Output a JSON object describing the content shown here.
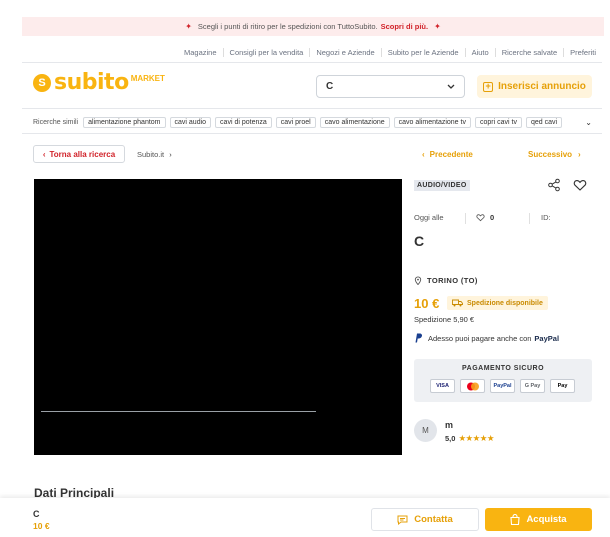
{
  "banner": {
    "text": "Scegli i punti di ritiro per le spedizioni con TuttoSubito.",
    "link": "Scopri di più."
  },
  "top_links": [
    "Magazine",
    "Consigli per la vendita",
    "Negozi e Aziende",
    "Subito per le Aziende",
    "Aiuto",
    "Ricerche salvate",
    "Preferiti"
  ],
  "logo": {
    "word": "subito",
    "sub": "MARKET"
  },
  "search": {
    "value": "C"
  },
  "header": {
    "insert_label": "Inserisci annuncio"
  },
  "related": {
    "label": "Ricerche simili",
    "chips": [
      "alimentazione phantom",
      "cavi audio",
      "cavi di potenza",
      "cavi proel",
      "cavo alimentazione",
      "cavo alimentazione tv",
      "copri cavi tv",
      "qed cavi"
    ]
  },
  "nav": {
    "back": "Torna alla ricerca",
    "crumb": "Subito.it",
    "prev": "Precedente",
    "next": "Successivo"
  },
  "ad": {
    "category": "AUDIO/VIDEO",
    "date": "Oggi alle",
    "likes": "0",
    "id_label": "ID:",
    "title": "C",
    "location": "TORINO (TO)",
    "price": "10 €",
    "shipping_badge": "Spedizione disponibile",
    "shipping_cost": "Spedizione 5,90 €",
    "paypal_text": "Adesso puoi pagare anche con",
    "paypal_brand": "PayPal",
    "secure_title": "PAGAMENTO SICURO",
    "cards": [
      "VISA",
      "MC",
      "PayPal",
      "G Pay",
      "Pay"
    ]
  },
  "seller": {
    "initial": "M",
    "name": "m",
    "rating": "5,0",
    "stars": "★★★★★"
  },
  "section": {
    "title": "Dati Principali"
  },
  "bottom": {
    "title": "C",
    "price": "10 €",
    "contact": "Contatta",
    "buy": "Acquista"
  },
  "colors": {
    "accent": "#f9b411",
    "red": "#d1232a"
  }
}
